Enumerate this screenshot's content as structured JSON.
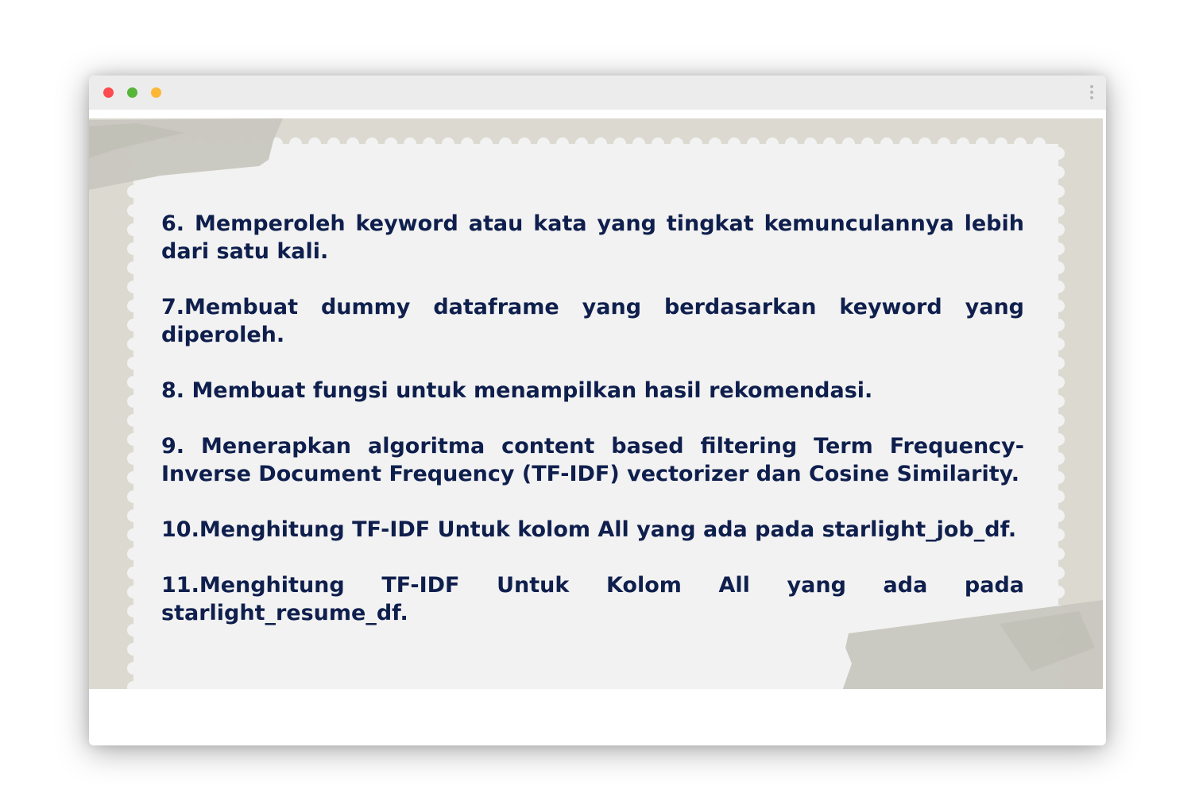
{
  "window": {
    "controls": [
      "close",
      "minimize",
      "maximize"
    ],
    "menu_icon": "kebab-menu-icon"
  },
  "slide": {
    "colors": {
      "background": "#dcdad0",
      "paper": "#f2f2f2",
      "text": "#0f1f4d",
      "tape": "#c9c8bf"
    },
    "items": [
      "6. Memperoleh keyword atau kata yang tingkat kemunculannya lebih dari satu kali.",
      "7.Membuat dummy dataframe yang berdasarkan keyword yang diperoleh.",
      "8. Membuat fungsi untuk menampilkan hasil rekomendasi.",
      "9. Menerapkan algoritma content based filtering Term Frequency-Inverse Document Frequency (TF-IDF) vectorizer dan Cosine Similarity.",
      "10.Menghitung TF-IDF Untuk kolom All yang ada pada starlight_job_df.",
      "11.Menghitung TF-IDF Untuk Kolom All yang ada pada starlight_resume_df."
    ]
  }
}
